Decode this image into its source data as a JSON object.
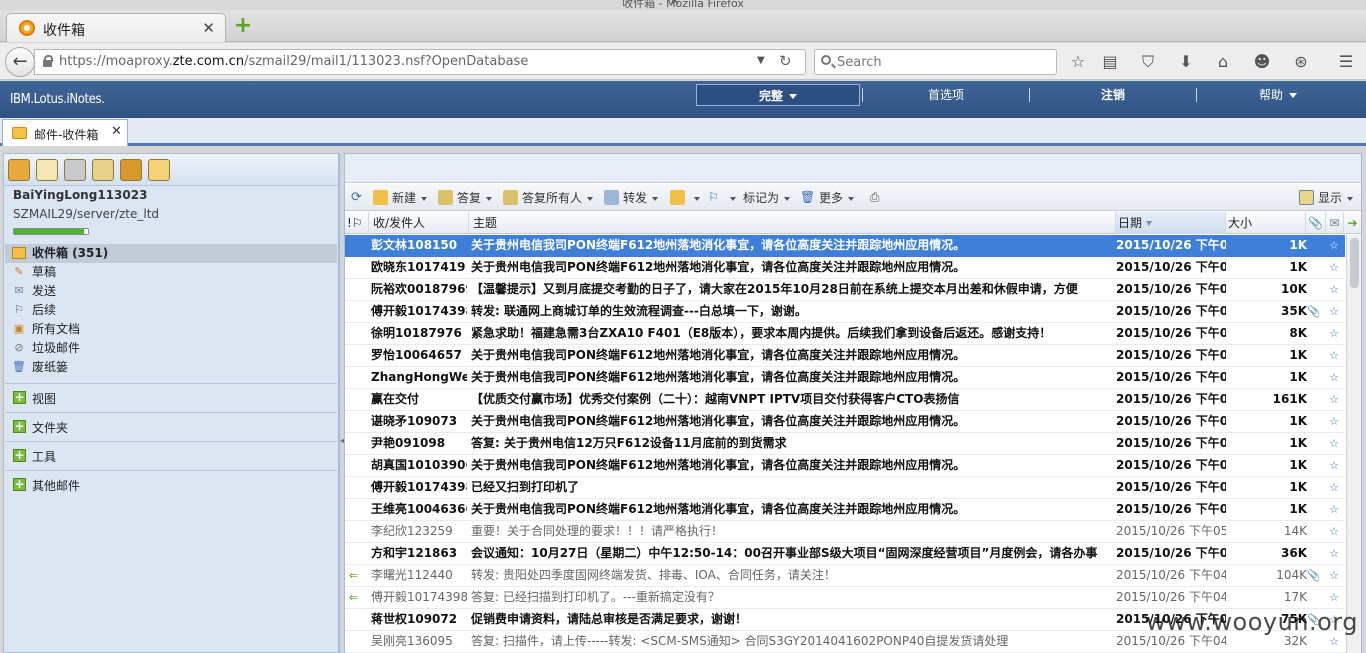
{
  "window": {
    "title": "收件箱 - Mozilla Firefox"
  },
  "browser": {
    "tab_title": "收件箱",
    "url_prefix": "https://moaproxy.",
    "url_host": "zte.com.cn",
    "url_path": "/szmail29/mail1/113023.nsf?OpenDatabase",
    "search_placeholder": "Search"
  },
  "banner": {
    "brand": "IBM.Lotus.iNotes.",
    "menus": [
      "完整",
      "首选项",
      "注销",
      "帮助"
    ]
  },
  "app_tab": {
    "label": "邮件-收件箱"
  },
  "sidebar": {
    "user": "BaiYingLong113023",
    "server": "SZMAIL29/server/zte_ltd",
    "quota_fraction": 0.95,
    "folders": [
      {
        "label": "收件箱 (351)",
        "icon": "inbox-icon"
      },
      {
        "label": "草稿",
        "icon": "draft-icon"
      },
      {
        "label": "发送",
        "icon": "sent-icon"
      },
      {
        "label": "后续",
        "icon": "flag-icon"
      },
      {
        "label": "所有文档",
        "icon": "all-docs-icon"
      },
      {
        "label": "垃圾邮件",
        "icon": "junk-icon"
      },
      {
        "label": "废纸篓",
        "icon": "trash-icon"
      }
    ],
    "sections": [
      "视图",
      "文件夹",
      "工具",
      "其他邮件"
    ]
  },
  "toolbar": {
    "new": "新建",
    "reply": "答复",
    "reply_all": "答复所有人",
    "forward": "转发",
    "mark_as": "标记为",
    "more": "更多",
    "display": "显示"
  },
  "columns": {
    "from": "收/发件人",
    "subject": "主题",
    "date": "日期",
    "size": "大小"
  },
  "messages": [
    {
      "from": "彭文林108150",
      "subject": "关于贵州电信我司PON终端F612地州落地消化事宜，请各位高度关注并跟踪地州应用情况。",
      "date": "2015/10/26 下午06:",
      "size": "1K",
      "state": "selected",
      "icon": "",
      "att": ""
    },
    {
      "from": "欧晓东10174191",
      "subject": "关于贵州电信我司PON终端F612地州落地消化事宜，请各位高度关注并跟踪地州应用情况。",
      "date": "2015/10/26 下午05:",
      "size": "1K",
      "state": "unread",
      "icon": "",
      "att": ""
    },
    {
      "from": "阮裕欢00187969",
      "subject": "【温馨提示】又到月底提交考勤的日子了，请大家在2015年10月28日前在系统上提交本月出差和休假申请，方便",
      "date": "2015/10/26 下午05:",
      "size": "10K",
      "state": "unread",
      "icon": "",
      "att": ""
    },
    {
      "from": "傅开毅10174398",
      "subject": "转发: 联通网上商城订单的生效流程调查---白总填一下，谢谢。",
      "date": "2015/10/26 下午05:",
      "size": "35K",
      "state": "unread",
      "icon": "",
      "att": "📎"
    },
    {
      "from": "徐明10187976",
      "subject": "紧急求助！福建急需3台ZXA10 F401（E8版本），要求本周内提供。后续我们拿到设备后返还。感谢支持！",
      "date": "2015/10/26 下午05:",
      "size": "8K",
      "state": "unread",
      "icon": "",
      "att": ""
    },
    {
      "from": "罗怡10064657",
      "subject": "关于贵州电信我司PON终端F612地州落地消化事宜，请各位高度关注并跟踪地州应用情况。",
      "date": "2015/10/26 下午05:",
      "size": "1K",
      "state": "unread",
      "icon": "",
      "att": ""
    },
    {
      "from": "ZhangHongWei17",
      "subject": "关于贵州电信我司PON终端F612地州落地消化事宜，请各位高度关注并跟踪地州应用情况。",
      "date": "2015/10/26 下午05:",
      "size": "1K",
      "state": "unread",
      "icon": "",
      "att": ""
    },
    {
      "from": "赢在交付",
      "subject": "【优质交付赢市场】优秀交付案例（二十）：越南VNPT IPTV项目交付获得客户CTO表扬信",
      "date": "2015/10/26 下午05:",
      "size": "161K",
      "state": "unread",
      "icon": "",
      "att": ""
    },
    {
      "from": "谌晓矛109073",
      "subject": "关于贵州电信我司PON终端F612地州落地消化事宜，请各位高度关注并跟踪地州应用情况。",
      "date": "2015/10/26 下午05:",
      "size": "1K",
      "state": "unread",
      "icon": "",
      "att": ""
    },
    {
      "from": "尹艳091098",
      "subject": "答复: 关于贵州电信12万只F612设备11月底前的到货需求",
      "date": "2015/10/26 下午05:",
      "size": "1K",
      "state": "unread",
      "icon": "",
      "att": ""
    },
    {
      "from": "胡真国10103906",
      "subject": "关于贵州电信我司PON终端F612地州落地消化事宜，请各位高度关注并跟踪地州应用情况。",
      "date": "2015/10/26 下午05:",
      "size": "1K",
      "state": "unread",
      "icon": "",
      "att": ""
    },
    {
      "from": "傅开毅10174398",
      "subject": "已经又扫到打印机了",
      "date": "2015/10/26 下午05:",
      "size": "1K",
      "state": "unread",
      "icon": "",
      "att": ""
    },
    {
      "from": "王维亮10046366",
      "subject": "关于贵州电信我司PON终端F612地州落地消化事宜，请各位高度关注并跟踪地州应用情况。",
      "date": "2015/10/26 下午05:",
      "size": "1K",
      "state": "unread",
      "icon": "",
      "att": ""
    },
    {
      "from": "李纪欣123259",
      "subject": "重要！关于合同处理的要求！！！请严格执行！",
      "date": "2015/10/26 下午05:0",
      "size": "14K",
      "state": "read",
      "icon": "",
      "att": ""
    },
    {
      "from": "方和宇121863",
      "subject": "会议通知：10月27日（星期二）中午12:50-14：00召开事业部S级大项目“固网深度经营项目”月度例会，请各办事",
      "date": "2015/10/26 下午04:",
      "size": "36K",
      "state": "unread",
      "icon": "",
      "att": ""
    },
    {
      "from": "李曙光112440",
      "subject": "转发: 贵阳处四季度固网终端发货、排毒、IOA、合同任务，请关注！",
      "date": "2015/10/26 下午04:",
      "size": "104K",
      "state": "read",
      "icon": "⇐",
      "att": "📎"
    },
    {
      "from": "傅开毅10174398",
      "subject": "答复: 已经扫描到打印机了。---重新搞定没有？",
      "date": "2015/10/26 下午04:",
      "size": "17K",
      "state": "read",
      "icon": "⇐",
      "att": ""
    },
    {
      "from": "蒋世权109072",
      "subject": "促销费申请资料，请陆总审核是否满足要求，谢谢！",
      "date": "2015/10/26 下午04:",
      "size": "75K",
      "state": "unread",
      "icon": "",
      "att": "📎"
    },
    {
      "from": "吴刚亮136095",
      "subject": "答复: 扫描件，请上传-----转发: <SCM-SMS通知> 合同S3GY2014041602PONP40自提发货请处理",
      "date": "2015/10/26 下午04:1",
      "size": "32K",
      "state": "read",
      "icon": "",
      "att": ""
    }
  ],
  "watermark": "www.wooyun.org"
}
